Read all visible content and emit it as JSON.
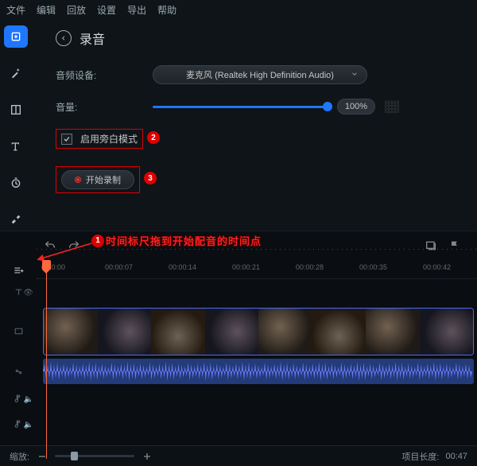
{
  "menu": {
    "file": "文件",
    "edit": "编辑",
    "playback": "回放",
    "settings": "设置",
    "export": "导出",
    "help": "帮助"
  },
  "panel": {
    "title": "录音",
    "audio_device_label": "音频设备:",
    "audio_device_value": "麦克风 (Realtek High Definition Audio)",
    "volume_label": "音量:",
    "volume_value": "100%",
    "checkbox_label": "启用旁白模式",
    "record_label": "开始录制"
  },
  "annotation": {
    "text": "时间标尺拖到开始配音的时间点"
  },
  "callouts": {
    "c1": "1",
    "c2": "2",
    "c3": "3"
  },
  "ruler": [
    "0:00:00",
    "00:00:07",
    "00:00:14",
    "00:00:21",
    "00:00:28",
    "00:00:35",
    "00:00:42"
  ],
  "bottom": {
    "zoom_label": "缩放:",
    "length_label": "项目长度:",
    "length_value": "00:47"
  }
}
